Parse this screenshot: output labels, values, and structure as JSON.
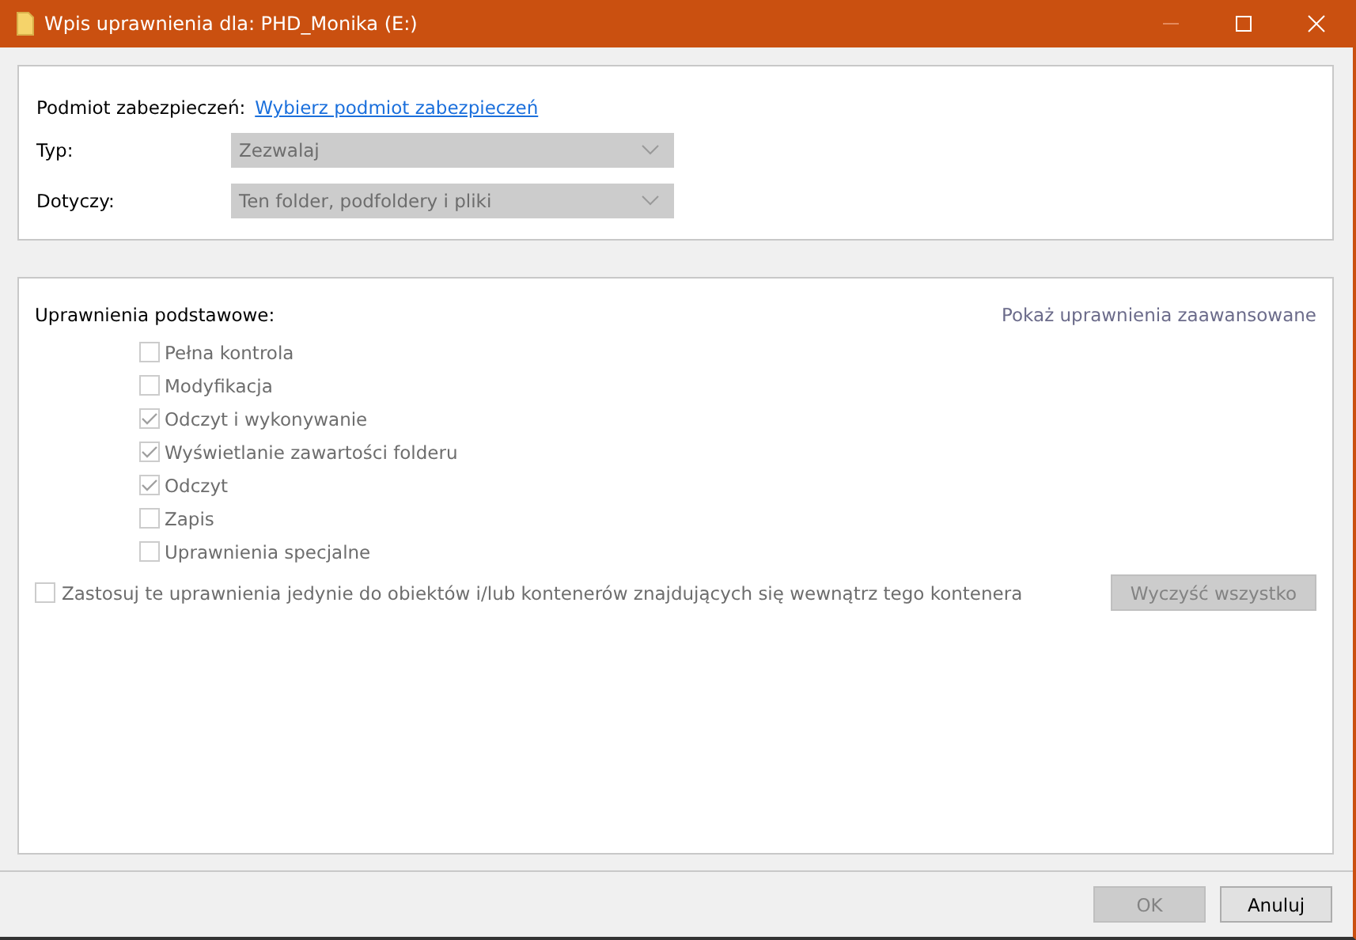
{
  "window": {
    "title": "Wpis uprawnienia dla: PHD_Monika (E:)",
    "minimize_disabled": true
  },
  "principal": {
    "label": "Podmiot zabezpieczeń:",
    "link": "Wybierz podmiot zabezpieczeń"
  },
  "fields": [
    {
      "label": "Typ:",
      "value": "Zezwalaj",
      "disabled": true
    },
    {
      "label": "Dotyczy:",
      "value": "Ten folder, podfoldery i pliki",
      "disabled": true
    }
  ],
  "permissions": {
    "title": "Uprawnienia podstawowe:",
    "advanced_link": "Pokaż uprawnienia zaawansowane",
    "items": [
      {
        "label": "Pełna kontrola",
        "checked": false,
        "disabled": true
      },
      {
        "label": "Modyfikacja",
        "checked": false,
        "disabled": true
      },
      {
        "label": "Odczyt i wykonywanie",
        "checked": true,
        "disabled": true
      },
      {
        "label": "Wyświetlanie zawartości folderu",
        "checked": true,
        "disabled": true
      },
      {
        "label": "Odczyt",
        "checked": true,
        "disabled": true
      },
      {
        "label": "Zapis",
        "checked": false,
        "disabled": true
      },
      {
        "label": "Uprawnienia specjalne",
        "checked": false,
        "disabled": true
      }
    ],
    "apply_only": {
      "label": "Zastosuj te uprawnienia jedynie do obiektów i/lub kontenerów znajdujących się wewnątrz tego kontenera",
      "checked": false,
      "disabled": true
    },
    "clear_button": {
      "label": "Wyczyść wszystko",
      "disabled": true
    }
  },
  "buttons": [
    {
      "label": "OK",
      "disabled": true
    },
    {
      "label": "Anuluj",
      "disabled": false
    }
  ]
}
